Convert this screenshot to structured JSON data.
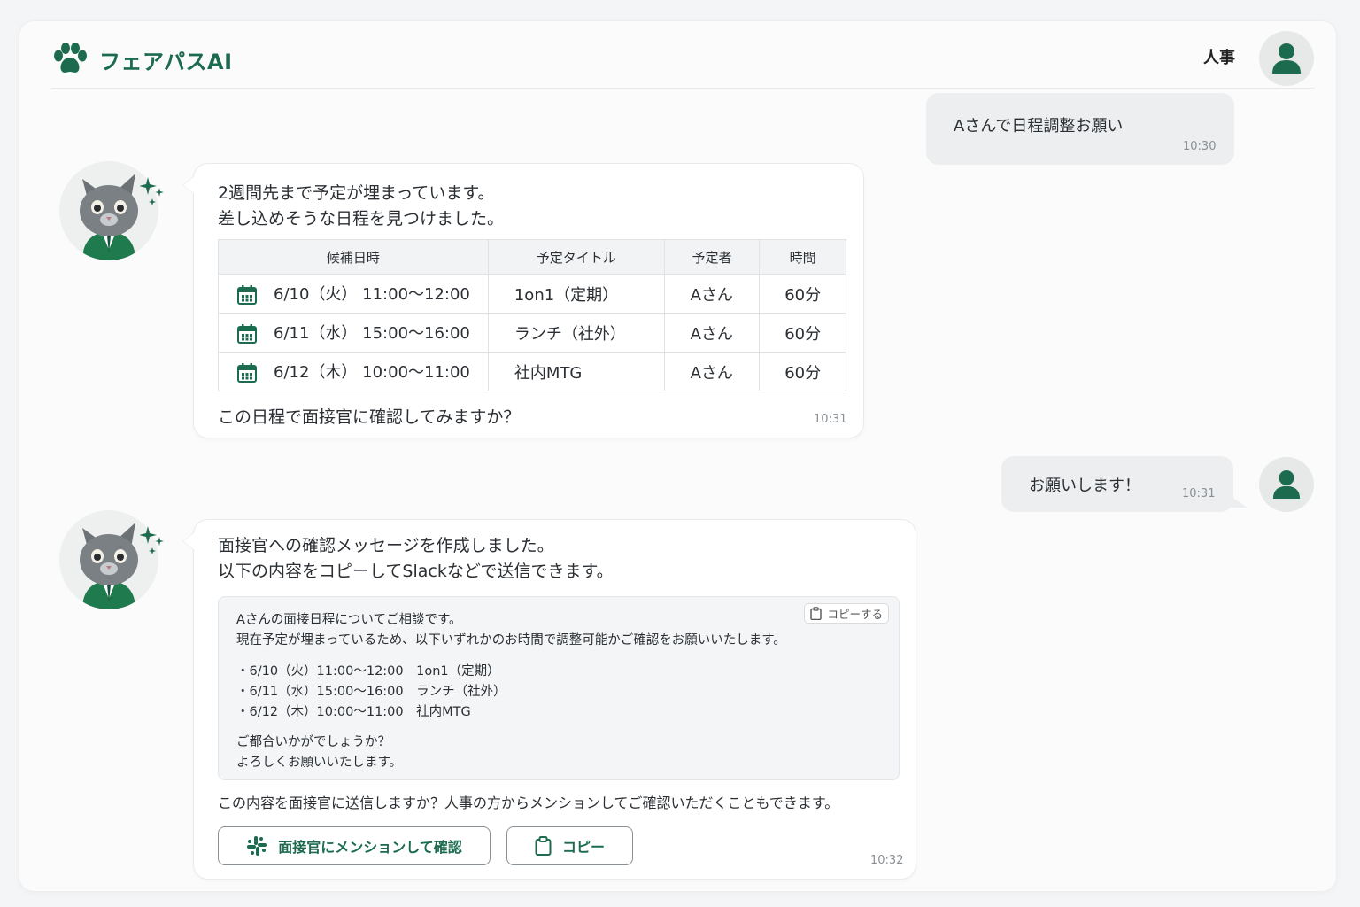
{
  "app": {
    "name": "フェアパスAI",
    "user_label": "人事"
  },
  "colors": {
    "brand": "#1d6b4f",
    "bubble_user": "#eceeef"
  },
  "messages": {
    "m1": {
      "text": "Aさんで日程調整お願い",
      "time": "10:30"
    },
    "m2": {
      "line1": "2週間先まで予定が埋まっています。",
      "line2": "差し込めそうな日程を見つけました。",
      "table": {
        "headers": [
          "候補日時",
          "予定タイトル",
          "予定者",
          "時間"
        ],
        "rows": [
          {
            "datetime": "6/10（火） 11:00〜12:00",
            "title": "1on1（定期）",
            "person": "Aさん",
            "duration": "60分"
          },
          {
            "datetime": "6/11（水） 15:00〜16:00",
            "title": "ランチ（社外）",
            "person": "Aさん",
            "duration": "60分"
          },
          {
            "datetime": "6/12（木） 10:00〜11:00",
            "title": "社内MTG",
            "person": "Aさん",
            "duration": "60分"
          }
        ]
      },
      "question": "この日程で面接官に確認してみますか？",
      "time": "10:31"
    },
    "m3": {
      "text": "お願いします！",
      "time": "10:31"
    },
    "m4": {
      "line1": "面接官への確認メッセージを作成しました。",
      "line2": "以下の内容をコピーしてSlackなどで送信できます。",
      "copy_chip": "コピーする",
      "draft": {
        "l1": "Aさんの面接日程についてご相談です。",
        "l2": "現在予定が埋まっているため、以下いずれかのお時間で調整可能かご確認をお願いいたします。",
        "b1": "・6/10（火）11:00〜12:00　1on1（定期）",
        "b2": "・6/11（水）15:00〜16:00　ランチ（社外）",
        "b3": "・6/12（木）10:00〜11:00　社内MTG",
        "c1": "ご都合いかがでしょうか？",
        "c2": "よろしくお願いいたします。"
      },
      "footer": "この内容を面接官に送信しますか？人事の方からメンションしてご確認いただくこともできます。",
      "mention_button": "面接官にメンションして確認",
      "copy_button": "コピー",
      "time": "10:32"
    }
  }
}
